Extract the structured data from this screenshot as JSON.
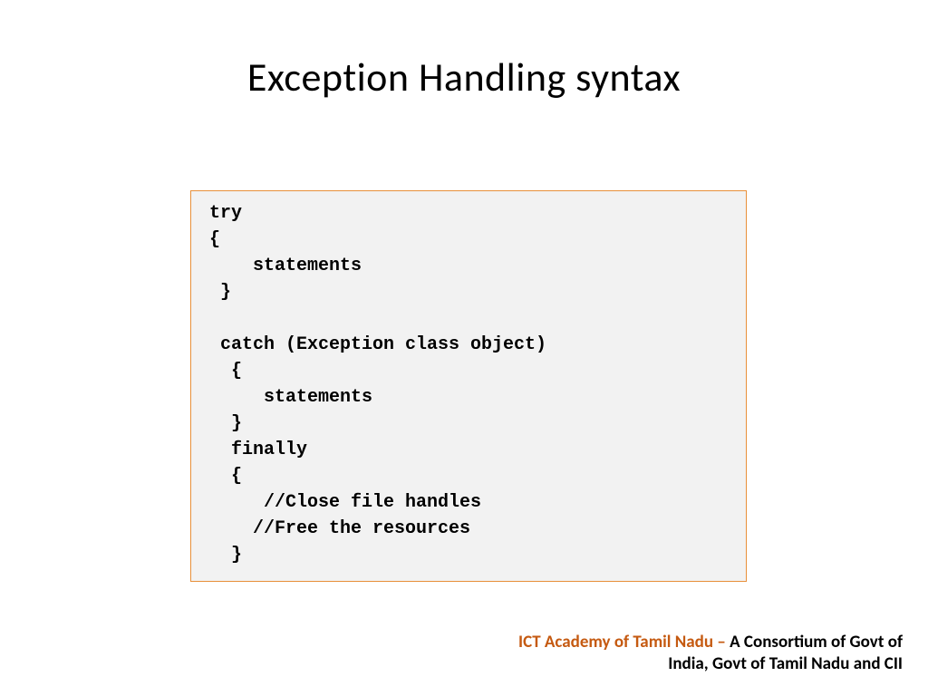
{
  "title": "Exception Handling syntax",
  "code": "try\n{\n    statements\n }\n\n catch (Exception class object)\n  {\n     statements\n  }\n  finally\n  {\n     //Close file handles\n    //Free the resources\n  }",
  "footer": {
    "org": "ICT Academy of Tamil Nadu",
    "dash": " – ",
    "desc_line1": "A Consortium of Govt of",
    "desc_line2": "India, Govt of Tamil Nadu and CII"
  }
}
